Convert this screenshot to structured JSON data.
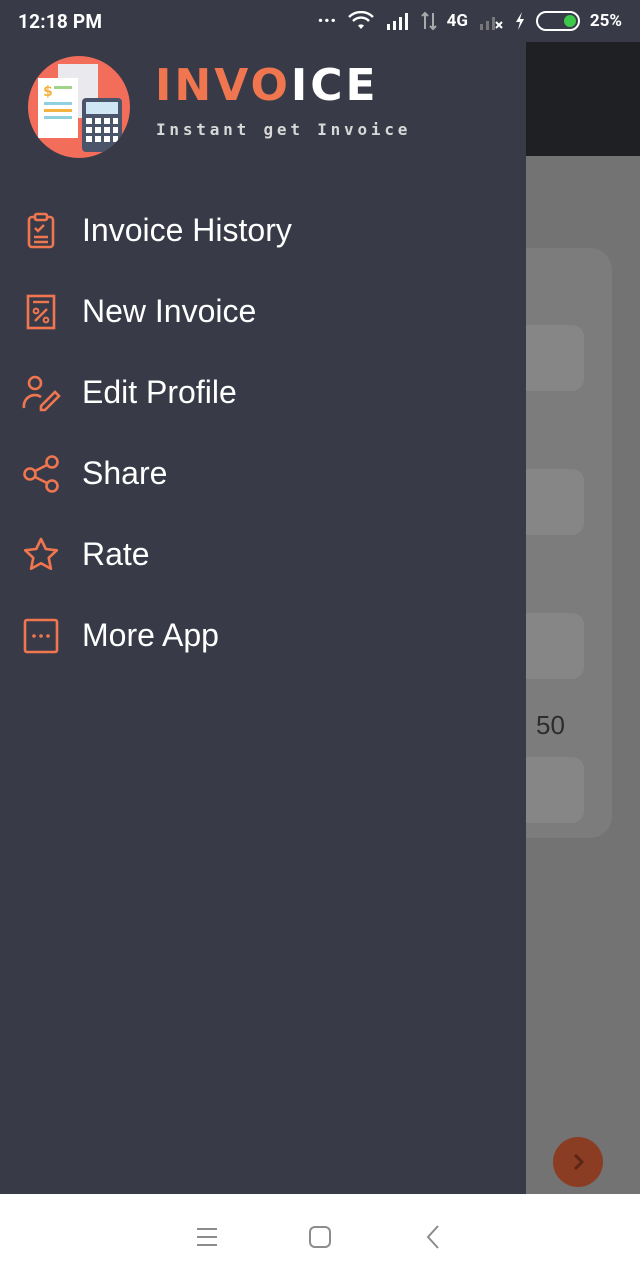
{
  "status": {
    "time": "12:18 PM",
    "network": "4G",
    "battery": "25%",
    "dots": "..."
  },
  "drawer": {
    "brand_part1": "INVO",
    "brand_part2": "ICE",
    "tagline": "Instant get Invoice",
    "items": [
      {
        "label": "Invoice History",
        "icon": "clipboard-icon"
      },
      {
        "label": "New Invoice",
        "icon": "receipt-icon"
      },
      {
        "label": "Edit Profile",
        "icon": "user-edit-icon"
      },
      {
        "label": "Share",
        "icon": "share-icon"
      },
      {
        "label": "Rate",
        "icon": "star-icon"
      },
      {
        "label": "More App",
        "icon": "more-icon"
      }
    ]
  },
  "background": {
    "value": "50"
  },
  "colors": {
    "accent": "#f0764f",
    "drawer_bg": "#383b47"
  }
}
